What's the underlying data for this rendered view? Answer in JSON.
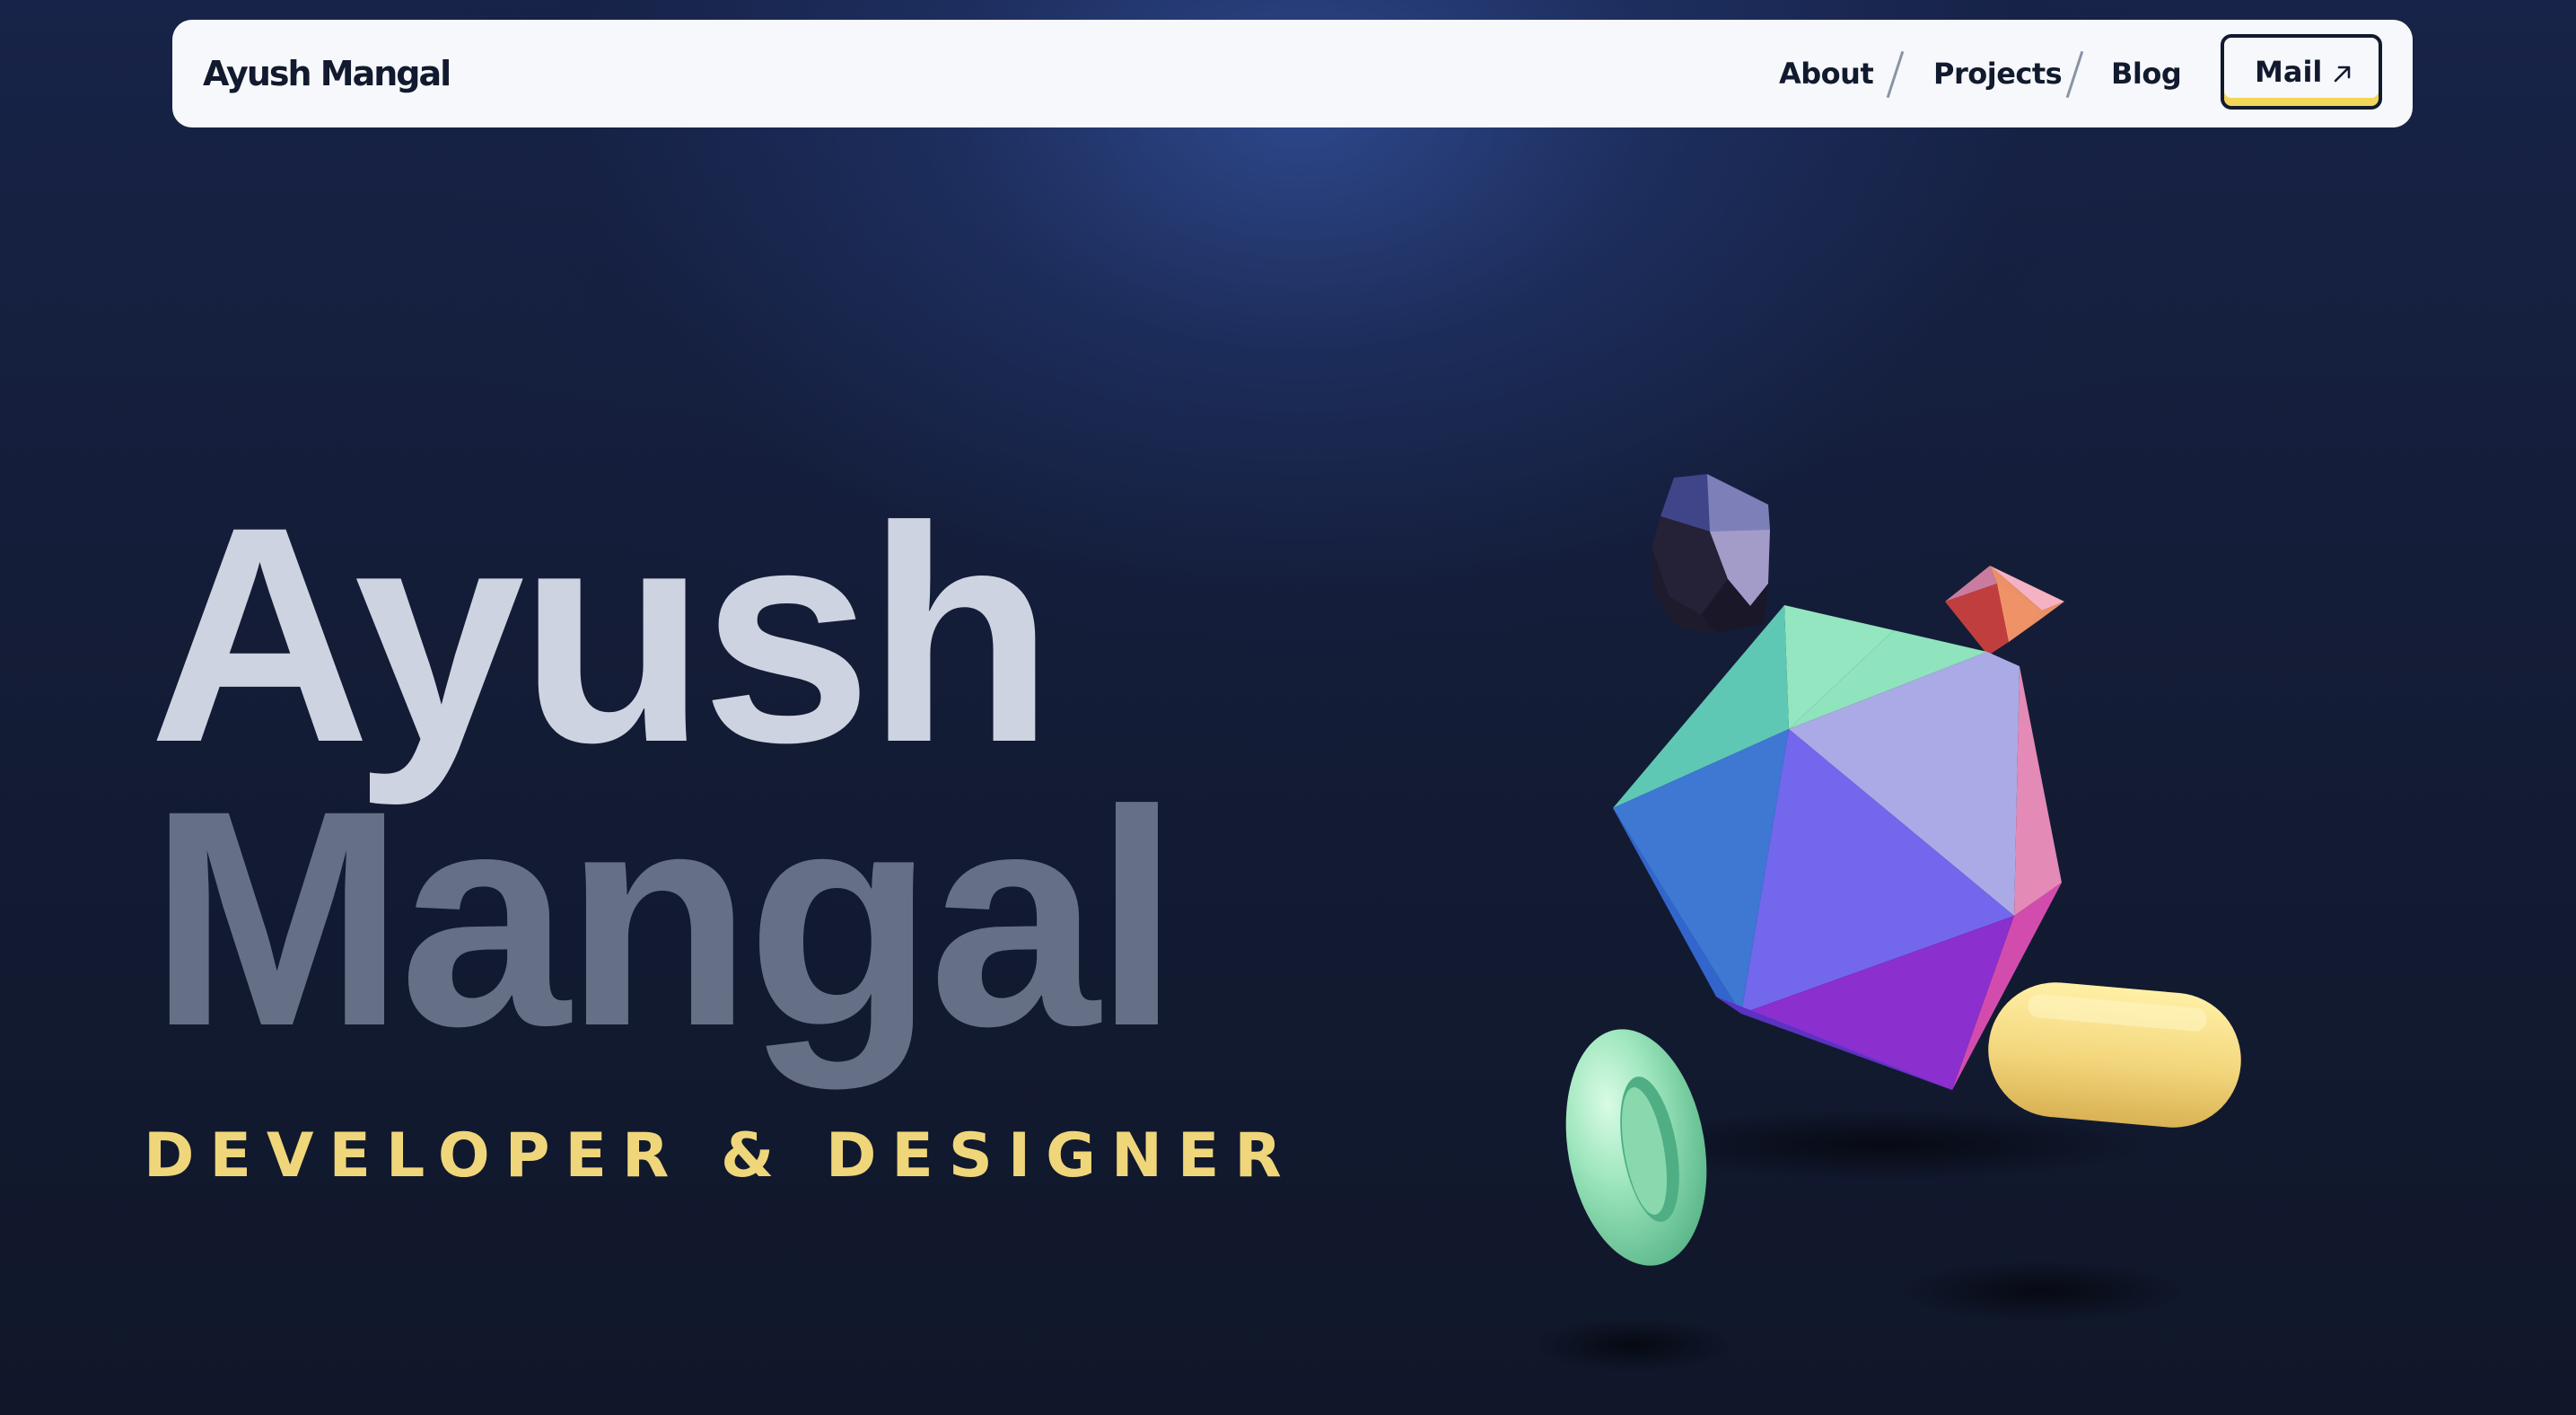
{
  "header": {
    "brand": "Ayush Mangal",
    "nav": {
      "about": "About",
      "projects": "Projects",
      "blog": "Blog",
      "mail": "Mail"
    },
    "mail_icon": "arrow-up-right-icon"
  },
  "hero": {
    "first_name": "Ayush",
    "last_name": "Mangal",
    "tagline": "DEVELOPER & DESIGNER"
  },
  "colors": {
    "background": "#111a30",
    "navbar": "#f6f8fb",
    "text_dark": "#111a2e",
    "first_name": "#cdd3e0",
    "last_name": "#657086",
    "accent": "#f0d67a"
  }
}
